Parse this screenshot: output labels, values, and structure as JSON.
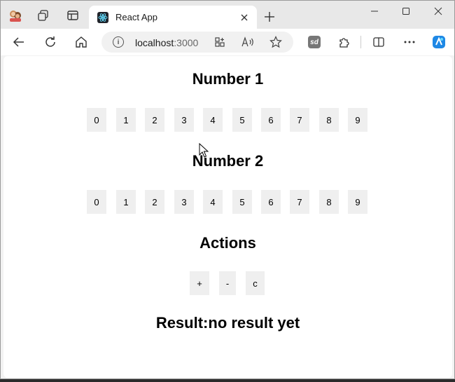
{
  "browser": {
    "tab_title": "React App",
    "url_host": "localhost",
    "url_port": ":3000"
  },
  "page": {
    "number1_heading": "Number 1",
    "number2_heading": "Number 2",
    "actions_heading": "Actions",
    "digits": [
      "0",
      "1",
      "2",
      "3",
      "4",
      "5",
      "6",
      "7",
      "8",
      "9"
    ],
    "actions": [
      "+",
      "-",
      "c"
    ],
    "result_label": "Result:",
    "result_value": "no result yet"
  },
  "icons": {
    "profile": "profile-avatar-icon",
    "workspaces": "workspaces-icon",
    "tab_actions": "tab-actions-icon",
    "react_favicon": "react-logo-icon",
    "close_tab": "close-icon",
    "new_tab": "plus-icon",
    "minimize": "minimize-icon",
    "maximize": "maximize-icon",
    "close_window": "close-window-icon",
    "back": "back-arrow-icon",
    "refresh": "refresh-icon",
    "home": "home-icon",
    "site_info": "info-icon",
    "app_available": "app-grid-icon",
    "read_aloud": "read-aloud-icon",
    "favorite": "star-icon",
    "sd_extension": "sd-extension-icon",
    "extensions": "puzzle-icon",
    "split_screen": "split-screen-icon",
    "more": "more-icon",
    "copilot": "copilot-icon"
  },
  "colors": {
    "button_bg": "#efefef",
    "page_bg": "#ffffff",
    "chrome_bg": "#e8e8e8"
  }
}
